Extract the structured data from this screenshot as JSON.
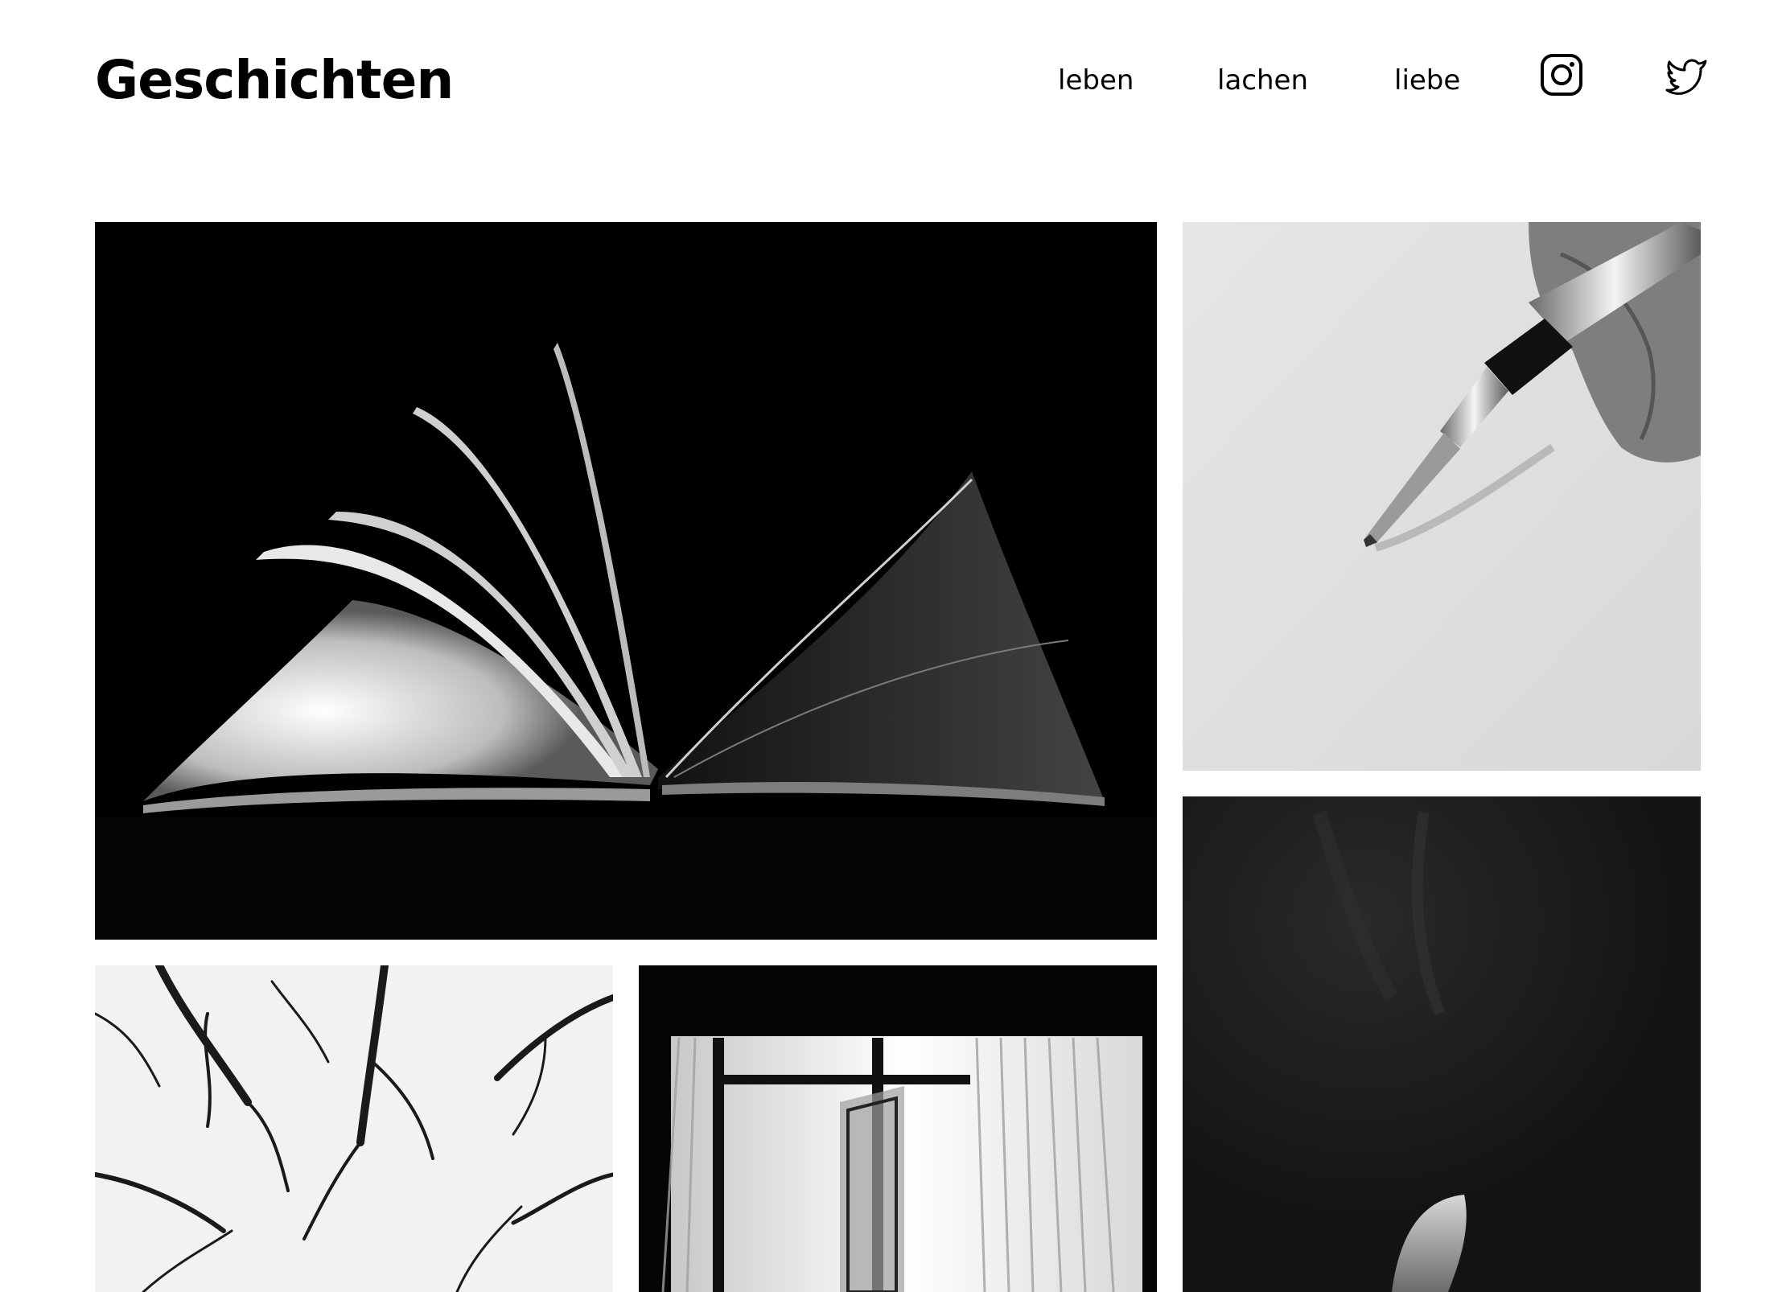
{
  "header": {
    "site_title": "Geschichten",
    "nav": [
      {
        "label": "leben"
      },
      {
        "label": "lachen"
      },
      {
        "label": "liebe"
      }
    ],
    "social": [
      {
        "icon": "instagram-icon"
      },
      {
        "icon": "twitter-icon"
      }
    ]
  },
  "gallery": {
    "tiles": [
      {
        "subject": "open-book",
        "tone": "#000000"
      },
      {
        "subject": "fountain-pen-hand",
        "tone": "#e4e4e2"
      },
      {
        "subject": "feather-in-dark",
        "tone": "#151515"
      },
      {
        "subject": "bare-tree-canopy",
        "tone": "#f2f2f2"
      },
      {
        "subject": "window-with-curtains",
        "tone": "#050505"
      }
    ]
  }
}
